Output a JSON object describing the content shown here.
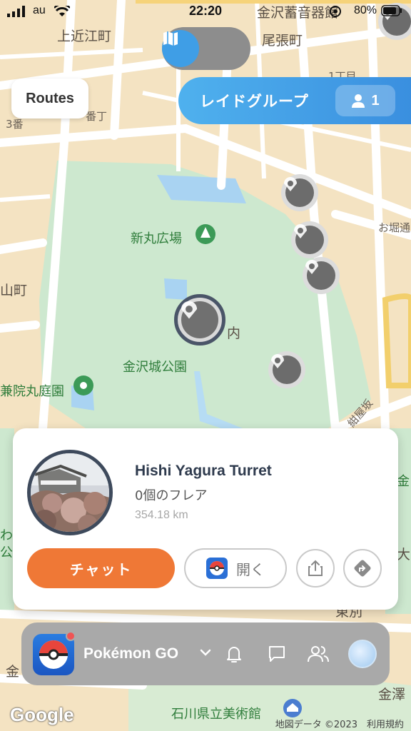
{
  "status_bar": {
    "carrier": "au",
    "time": "22:20",
    "battery": "80%"
  },
  "view_toggle": {
    "list_icon": "list-icon",
    "map_icon": "map-icon",
    "active": "map"
  },
  "routes_button": {
    "label": "Routes"
  },
  "raid_group": {
    "label": "レイドグループ",
    "count": "1",
    "color": "#4fb1ee"
  },
  "map": {
    "labels": [
      "金沢蓄音器館",
      "上近江町",
      "尾張町",
      "1丁目",
      "番丁",
      "3番",
      "新丸広場",
      "お堀通",
      "山町",
      "内",
      "金沢城公園",
      "兼院丸庭園",
      "紺屋坂",
      "金",
      "金澤",
      "石川県立美術館",
      "東別",
      "大",
      "わ",
      "公",
      "金"
    ]
  },
  "gym_card": {
    "title": "Hishi Yagura Turret",
    "flares": "0個のフレア",
    "distance": "354.18 km",
    "chat_label": "チャット",
    "open_label": "開く",
    "chat_color": "#ef7836"
  },
  "bottom_bar": {
    "app_name": "Pokémon GO"
  },
  "footer": {
    "google": "Google",
    "attribution": "地図データ ©2023　利用規約"
  }
}
